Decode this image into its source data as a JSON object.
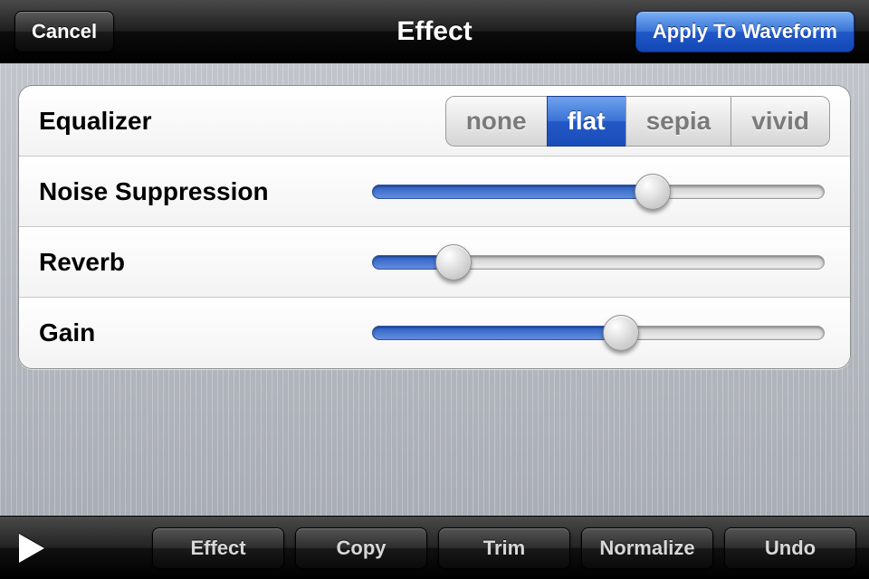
{
  "navbar": {
    "title": "Effect",
    "cancel": "Cancel",
    "apply": "Apply To Waveform"
  },
  "rows": {
    "equalizer": {
      "label": "Equalizer",
      "options": [
        "none",
        "flat",
        "sepia",
        "vivid"
      ],
      "selected": "flat"
    },
    "noiseSuppression": {
      "label": "Noise Suppression",
      "value": 62
    },
    "reverb": {
      "label": "Reverb",
      "value": 18
    },
    "gain": {
      "label": "Gain",
      "value": 55
    }
  },
  "toolbar": {
    "play": "play-icon",
    "effect": "Effect",
    "copy": "Copy",
    "trim": "Trim",
    "normalize": "Normalize",
    "undo": "Undo"
  }
}
